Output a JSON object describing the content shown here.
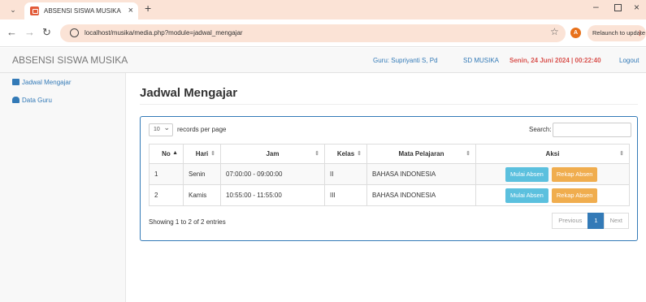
{
  "browser": {
    "tab_title": "ABSENSI SISWA MUSIKA",
    "url": "localhost/musika/media.php?module=jadwal_mengajar",
    "profile_initial": "A",
    "relaunch_label": "Relaunch to update"
  },
  "app": {
    "brand": "ABSENSI SISWA MUSIKA",
    "guru": "Guru: Supriyanti S, Pd",
    "school": "SD MUSIKA",
    "datetime": "Senin, 24 Juni 2024 | 00:22:40",
    "logout": "Logout"
  },
  "sidebar": {
    "items": [
      {
        "label": "Jadwal Mengajar",
        "icon": "chart-icon"
      },
      {
        "label": "Data Guru",
        "icon": "users-icon"
      }
    ]
  },
  "page": {
    "title": "Jadwal Mengajar"
  },
  "table_controls": {
    "page_length": "10",
    "length_label": "records per page",
    "search_label": "Search:",
    "search_value": ""
  },
  "table": {
    "columns": [
      "No",
      "Hari",
      "Jam",
      "Kelas",
      "Mata Pelajaran",
      "Aksi"
    ],
    "rows": [
      {
        "no": "1",
        "hari": "Senin",
        "jam": "07:00:00 - 09:00:00",
        "kelas": "II",
        "mapel": "BAHASA INDONESIA"
      },
      {
        "no": "2",
        "hari": "Kamis",
        "jam": "10:55:00 - 11:55:00",
        "kelas": "III",
        "mapel": "BAHASA INDONESIA"
      }
    ],
    "action_buttons": {
      "mulai": "Mulai Absen",
      "rekap": "Rekap Absen"
    }
  },
  "footer": {
    "info": "Showing 1 to 2 of 2 entries",
    "previous": "Previous",
    "current_page": "1",
    "next": "Next"
  },
  "colors": {
    "accent": "#337ab7",
    "info": "#5bc0de",
    "warning": "#f0ad4e",
    "date": "#d9534f"
  }
}
